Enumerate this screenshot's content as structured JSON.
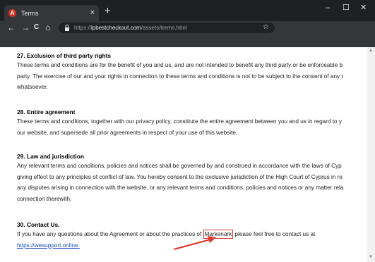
{
  "browser": {
    "tab_title": "Terms",
    "tab_close": "×",
    "new_tab": "+",
    "win_minimize": "–",
    "win_maximize": "☐",
    "win_close": "✕",
    "nav_back": "←",
    "nav_forward": "→",
    "nav_reload": "C",
    "nav_home": "⌂",
    "url_host": "lpbestcheckout.com",
    "url_path": "/assets/terms.html",
    "url_prefix": "https://",
    "bookmark": "☆"
  },
  "page": {
    "sections": [
      {
        "heading": "27. Exclusion of third party rights",
        "lines": [
          "These terms and conditions are for the benefit of you and us, and are not intended to benefit any third party or be enforceable b",
          "party. The exercise of our and your rights in connection to these terms and conditions is not to be subject to the consent of any t",
          "whatsoever."
        ]
      },
      {
        "heading": "28. Entire agreement",
        "lines": [
          "These terms and conditions, together with our privacy policy, constitute the entire agreement between you and us in regard to y",
          "our website, and supersede all prior agreements in respect of your use of this website."
        ]
      },
      {
        "heading": "29. Law and jurisdiction",
        "lines": [
          "Any relevant terms and conditions, policies and notices shall be governed by and construed in accordance with the laws of Cyp",
          "giving effect to any principles of conflict of law. You hereby consent to the exclusive jurisdiction of the High Court of Cyprus in re",
          "any disputes arising in connection with the website, or any relevant terms and conditions, policies and notices or any matter rela",
          "connection therewith."
        ]
      },
      {
        "heading": "30. Contact Us.",
        "line_before": "If you have any questions about the Agreement or about the practices of ",
        "highlighted": "Markenark",
        "line_after": " please feel free to contact us at",
        "link": "https://wesupport.online."
      }
    ]
  },
  "colors": {
    "highlight_box": "#e0372c",
    "annotation_arrow": "#e0372c",
    "link": "#1a4fbf"
  }
}
